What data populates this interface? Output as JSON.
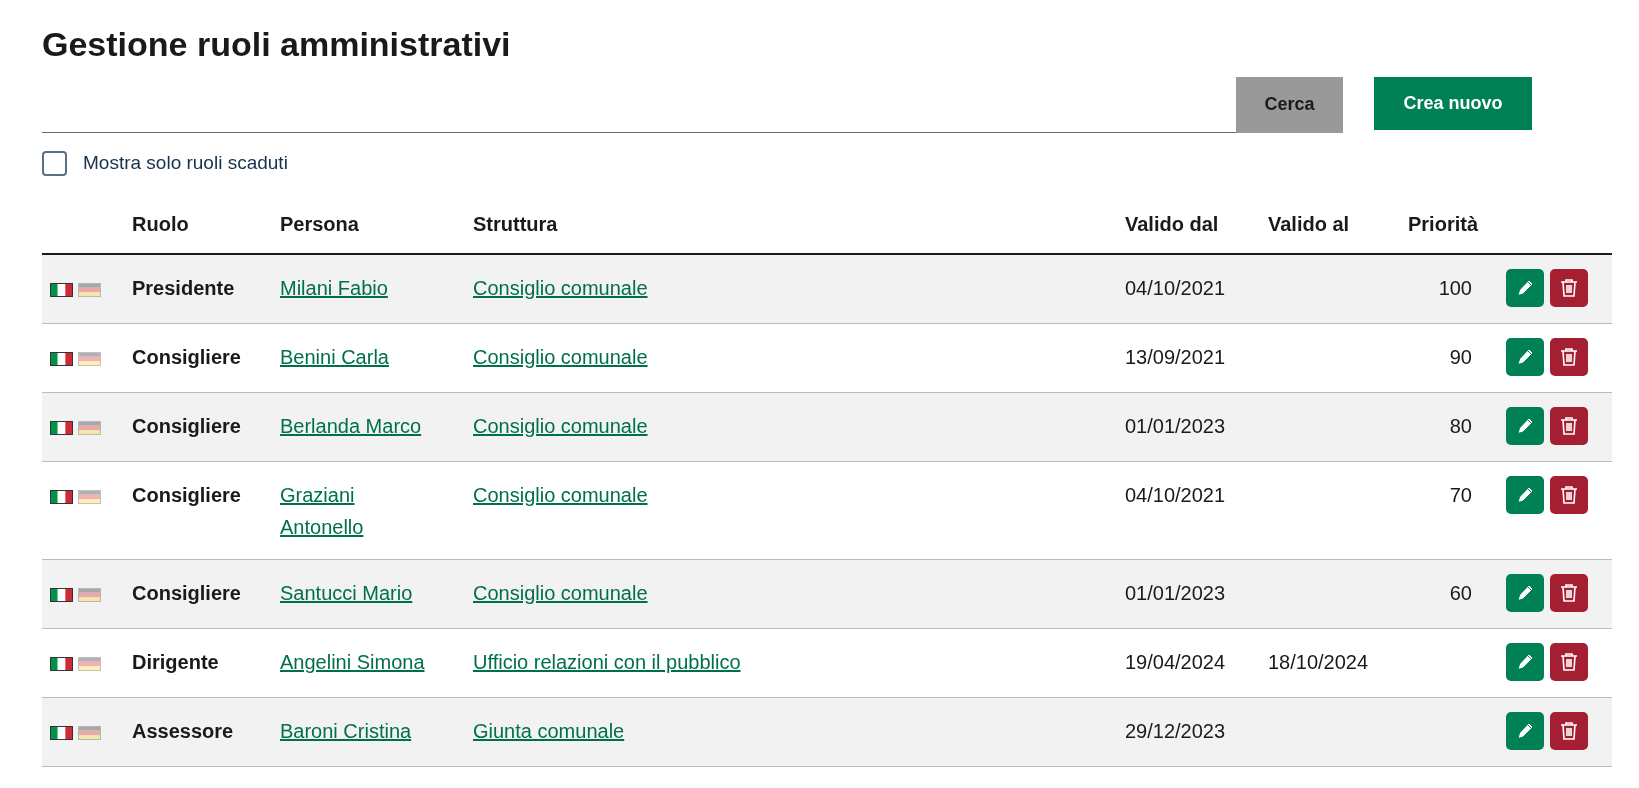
{
  "title": "Gestione ruoli amministrativi",
  "buttons": {
    "search": "Cerca",
    "create": "Crea nuovo"
  },
  "filter": {
    "label": "Mostra solo ruoli scaduti",
    "checked": false
  },
  "table": {
    "columns": [
      "Ruolo",
      "Persona",
      "Struttura",
      "Valido dal",
      "Valido al",
      "Priorità"
    ],
    "rows": [
      {
        "languages": [
          {
            "kind": "it",
            "active": true
          },
          {
            "kind": "de",
            "active": false
          }
        ],
        "role": "Presidente",
        "person": "Milani Fabio",
        "structure": "Consiglio comunale",
        "valid_from": "04/10/2021",
        "priority": "100"
      },
      {
        "languages": [
          {
            "kind": "it",
            "active": true
          },
          {
            "kind": "de",
            "active": false
          }
        ],
        "role": "Consigliere",
        "person": "Benini Carla",
        "structure": "Consiglio comunale",
        "valid_from": "13/09/2021",
        "priority": "90"
      },
      {
        "languages": [
          {
            "kind": "it",
            "active": true
          },
          {
            "kind": "de",
            "active": false
          }
        ],
        "role": "Consigliere",
        "person": "Berlanda Marco",
        "structure": "Consiglio comunale",
        "valid_from": "01/01/2023",
        "priority": "80"
      },
      {
        "languages": [
          {
            "kind": "it",
            "active": true
          },
          {
            "kind": "de",
            "active": false
          }
        ],
        "role": "Consigliere",
        "person": "Graziani Antonello",
        "structure": "Consiglio comunale",
        "valid_from": "04/10/2021",
        "priority": "70"
      },
      {
        "languages": [
          {
            "kind": "it",
            "active": true
          },
          {
            "kind": "de",
            "active": false
          }
        ],
        "role": "Consigliere",
        "person": "Santucci Mario",
        "structure": "Consiglio comunale",
        "valid_from": "01/01/2023",
        "priority": "60"
      },
      {
        "languages": [
          {
            "kind": "it",
            "active": true
          },
          {
            "kind": "de",
            "active": false
          }
        ],
        "role": "Dirigente",
        "person": "Angelini Simona",
        "structure": "Ufficio relazioni con il pubblico",
        "valid_from": "19/04/2024",
        "valid_to": "18/10/2024"
      },
      {
        "languages": [
          {
            "kind": "it",
            "active": true
          },
          {
            "kind": "de",
            "active": false
          }
        ],
        "role": "Assessore",
        "person": "Baroni Cristina",
        "structure": "Giunta comunale",
        "valid_from": "29/12/2023"
      }
    ]
  }
}
